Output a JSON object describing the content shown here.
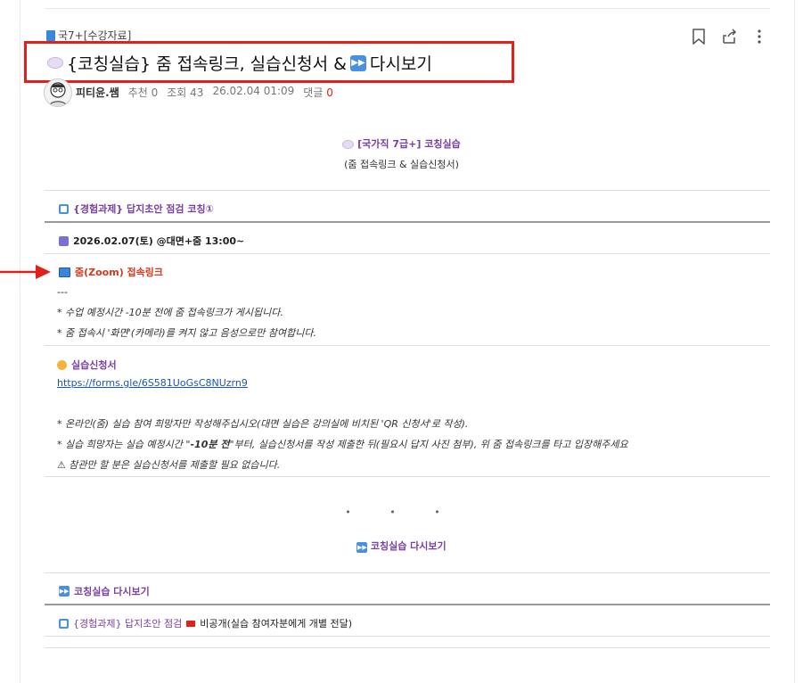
{
  "category": "국7+[수강자료]",
  "title": "{코칭실습} 줌 접속링크, 실습신청서 &",
  "title_tail": "다시보기",
  "meta": {
    "author": "피티윤.쌤",
    "recommend": "추천 0",
    "views": "조회 43",
    "datetime": "26.02.04 01:09",
    "comments_label": "댓글",
    "comments_count": "0"
  },
  "intro": {
    "heading": "[국가직 7급+] 코칭실습",
    "sub": "(줌 접속링크 & 실습신청서)"
  },
  "sections": {
    "task_title": "{경험과제} 답지초안 점검 코칭①",
    "date_line": "2026.02.07(토) @대면+줌 13:00~",
    "zoom_title": "줌(Zoom) 접속링크",
    "zoom_dash": "---",
    "zoom_note1": "* 수업 예정시간 -10분 전에 줌 접속링크가 게시됩니다.",
    "zoom_note2": "* 줌 접속시 '화면'(카메라)를 켜지 않고 음성으로만 참여합니다.",
    "form_title": "실습신청서",
    "form_link": "https://forms.gle/6S581UoGsC8NUzrn9",
    "form_note1": "* 온라인(줌) 실습 참여 희망자만 작성해주십시오(대면 실습은 강의실에 비치된 'QR 신청서'로 작성).",
    "form_note2_a": "* 실습 희망자는 실습 예정시간 \"",
    "form_note2_b": "-10분 전",
    "form_note2_c": "\"부터, 실습신청서를 작성 제출한 뒤(필요시 답지 사진 첨부), 위 줌 접속링크를 타고 입장해주세요",
    "form_note3": "⚠ 참관만 할 분은 실습신청서를 제출할 필요 없습니다.",
    "dots": "• • •",
    "replay_center": "코칭실습 다시보기",
    "replay_left": "코칭실습 다시보기",
    "bottom_a": "{경험과제} 답지초안 점검",
    "bottom_b": "비공개(실습 참여자분에게 개별 전달)"
  }
}
